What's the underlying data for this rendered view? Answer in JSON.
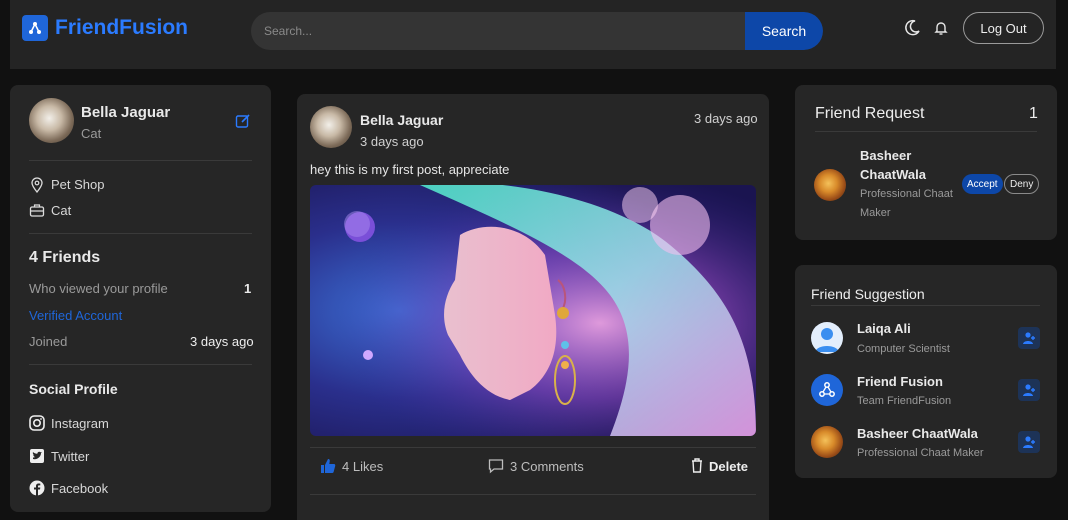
{
  "app": {
    "name": "FriendFusion"
  },
  "header": {
    "search_placeholder": "Search...",
    "search_button": "Search",
    "logout_label": "Log Out"
  },
  "profile": {
    "name": "Bella Jaguar",
    "subtitle": "Cat",
    "location": "Pet Shop",
    "work": "Cat",
    "friends_count": "4 Friends",
    "viewed_label": "Who viewed your profile",
    "viewed_count": "1",
    "verified": "Verified Account",
    "joined_label": "Joined",
    "joined_value": "3 days ago",
    "social_heading": "Social Profile",
    "socials": [
      "Instagram",
      "Twitter",
      "Facebook"
    ]
  },
  "post": {
    "author": "Bella Jaguar",
    "time_sub": "3 days ago",
    "time_right": "3 days ago",
    "text": "hey this is my first post, appreciate",
    "likes": "4 Likes",
    "comments": "3 Comments",
    "delete": "Delete"
  },
  "friend_request": {
    "title": "Friend Request",
    "count": "1",
    "name_line1": "Basheer",
    "name_line2": "ChaatWala",
    "role_line1": "Professional Chaat",
    "role_line2": "Maker",
    "accept": "Accept",
    "deny": "Deny"
  },
  "suggestions": {
    "title": "Friend Suggestion",
    "items": [
      {
        "name": "Laiqa Ali",
        "role": "Computer Scientist"
      },
      {
        "name": "Friend Fusion",
        "role": "Team FriendFusion"
      },
      {
        "name": "Basheer ChaatWala",
        "role": "Professional Chaat Maker"
      }
    ]
  },
  "colors": {
    "accent": "#1f66d9",
    "link": "#2b7bff",
    "card": "#262626",
    "background": "#111111"
  }
}
